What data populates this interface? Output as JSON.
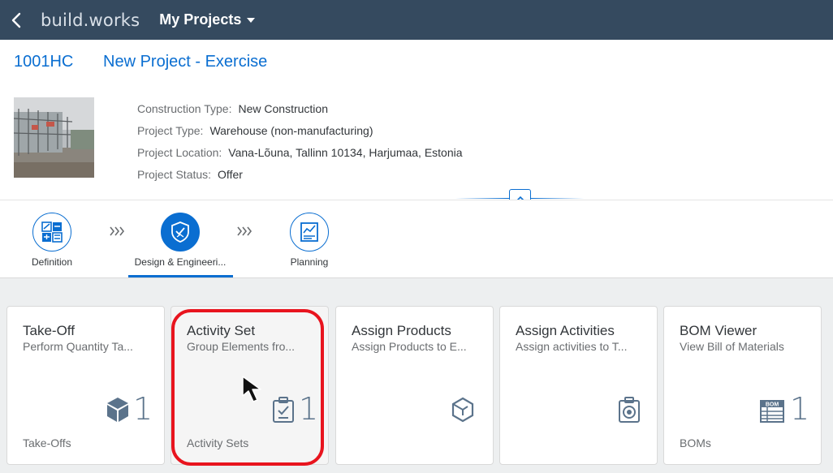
{
  "shell": {
    "brand_a": "build",
    "brand_dot": ".",
    "brand_b": "works",
    "menu_title": "My Projects",
    "color": "#354a5f"
  },
  "project": {
    "id": "1001HC",
    "title": "New Project - Exercise",
    "attributes": [
      {
        "label": "Construction Type:",
        "value": "New Construction"
      },
      {
        "label": "Project Type:",
        "value": "Warehouse (non-manufacturing)"
      },
      {
        "label": "Project Location:",
        "value": "Vana-Lõuna, Tallinn 10134, Harjumaa, Estonia"
      },
      {
        "label": "Project Status:",
        "value": "Offer"
      }
    ]
  },
  "process_steps": [
    {
      "label": "Definition",
      "icon": "calculator-icon",
      "active": false
    },
    {
      "label": "Design & Engineeri...",
      "icon": "shield-icon",
      "active": true
    },
    {
      "label": "Planning",
      "icon": "document-chart-icon",
      "active": false
    }
  ],
  "tiles": [
    {
      "title": "Take-Off",
      "subtitle": "Perform Quantity Ta...",
      "icon": "cube-icon",
      "count": "1",
      "footer": "Take-Offs"
    },
    {
      "title": "Activity Set",
      "subtitle": "Group Elements fro...",
      "icon": "clipboard-check-icon",
      "count": "1",
      "footer": "Activity Sets"
    },
    {
      "title": "Assign Products",
      "subtitle": "Assign Products to E...",
      "icon": "product-icon",
      "count": "",
      "footer": ""
    },
    {
      "title": "Assign Activities",
      "subtitle": "Assign activities to T...",
      "icon": "clipboard-target-icon",
      "count": "",
      "footer": ""
    },
    {
      "title": "BOM Viewer",
      "subtitle": "View Bill of Materials",
      "icon": "bom-icon",
      "icon_text": "BOM",
      "count": "1",
      "footer": "BOMs"
    }
  ],
  "colors": {
    "accent": "#0a6ed1",
    "highlight": "#e8141e",
    "tile_numeric": "#5b738b"
  }
}
